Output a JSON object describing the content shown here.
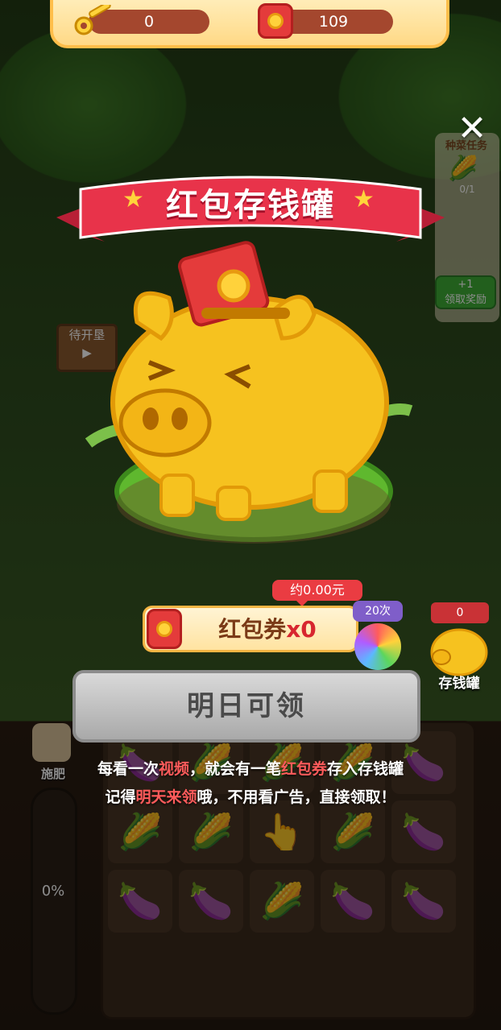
{
  "resources": {
    "keys_value": "0",
    "coupons_value": "109"
  },
  "task_panel": {
    "title": "种菜任务",
    "progress": "0/1",
    "reward_line1": "+1",
    "reward_line2": "领取奖励"
  },
  "background": {
    "sign_label": "待开垦",
    "fertilize_label": "施肥",
    "fertilize_percent": "0%"
  },
  "popup": {
    "title": "红包存钱罐",
    "amount_badge": "约0.00元",
    "coupon_text": "红包券",
    "coupon_multiplier": "x0",
    "claim_button_label": "明日可领",
    "instruction_line1_parts": [
      "每看一次",
      "视频",
      "，就会有一笔",
      "红包券",
      "存入存钱罐"
    ],
    "instruction_line2_parts": [
      "记得",
      "明天来领",
      "哦，不用看广告，直接领取！"
    ]
  },
  "side_buttons": {
    "wheel_count": "20次",
    "piggy_bank_count": "0",
    "piggy_bank_label": "存钱罐"
  },
  "colors": {
    "ribbon_red": "#e8334a",
    "highlight_red": "#ff5b5b",
    "button_disabled_gray": "#b5b5b5",
    "pig_gold": "#f6c21f"
  }
}
